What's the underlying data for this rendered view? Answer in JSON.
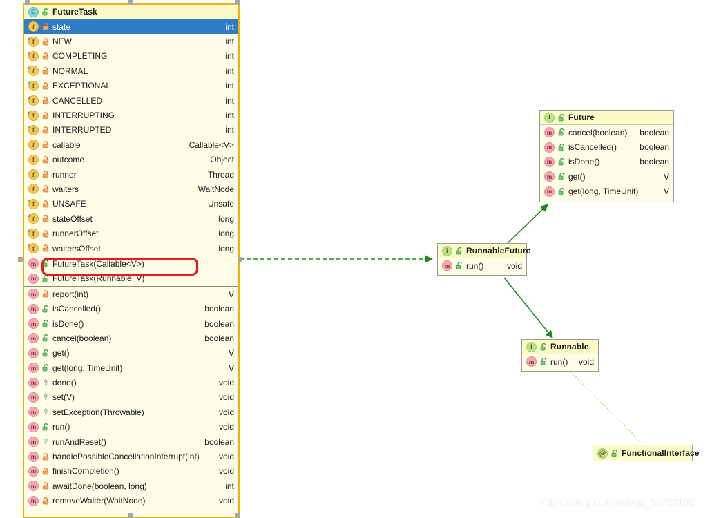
{
  "diagram": {
    "kind": "uml-class-diagram",
    "watermark": "https://blog.csdn.net/qq_33732195",
    "colors": {
      "box_fill": "#fdfde8",
      "header_fill": "#fbfbc8",
      "selected_border": "#f0b400",
      "row_selection": "#2f7bc4",
      "relation_green": "#1f8a1f",
      "relation_dotted": "#d6d69a",
      "annotation_red": "#e81b1b"
    }
  },
  "classes": {
    "future_task": {
      "name": "FutureTask",
      "stereotype": "class",
      "badge": "class-icon",
      "visibility": "public",
      "selected": true,
      "fields": [
        {
          "badge": "field-icon",
          "visibility": "private",
          "name": "state",
          "type": "int",
          "selected": true
        },
        {
          "badge": "static-field-icon",
          "visibility": "private",
          "name": "NEW",
          "type": "int",
          "selected": false
        },
        {
          "badge": "static-field-icon",
          "visibility": "private",
          "name": "COMPLETING",
          "type": "int",
          "selected": false
        },
        {
          "badge": "static-field-icon",
          "visibility": "private",
          "name": "NORMAL",
          "type": "int",
          "selected": false
        },
        {
          "badge": "static-field-icon",
          "visibility": "private",
          "name": "EXCEPTIONAL",
          "type": "int",
          "selected": false
        },
        {
          "badge": "static-field-icon",
          "visibility": "private",
          "name": "CANCELLED",
          "type": "int",
          "selected": false
        },
        {
          "badge": "static-field-icon",
          "visibility": "private",
          "name": "INTERRUPTING",
          "type": "int",
          "selected": false
        },
        {
          "badge": "static-field-icon",
          "visibility": "private",
          "name": "INTERRUPTED",
          "type": "int",
          "selected": false
        },
        {
          "badge": "field-icon",
          "visibility": "private",
          "name": "callable",
          "type": "Callable<V>",
          "selected": false
        },
        {
          "badge": "field-icon",
          "visibility": "private",
          "name": "outcome",
          "type": "Object",
          "selected": false
        },
        {
          "badge": "field-icon",
          "visibility": "private",
          "name": "runner",
          "type": "Thread",
          "selected": false
        },
        {
          "badge": "field-icon",
          "visibility": "private",
          "name": "waiters",
          "type": "WaitNode",
          "selected": false
        },
        {
          "badge": "static-field-icon",
          "visibility": "private",
          "name": "UNSAFE",
          "type": "Unsafe",
          "selected": false
        },
        {
          "badge": "static-field-icon",
          "visibility": "private",
          "name": "stateOffset",
          "type": "long",
          "selected": false
        },
        {
          "badge": "static-field-icon",
          "visibility": "private",
          "name": "runnerOffset",
          "type": "long",
          "selected": false
        },
        {
          "badge": "static-field-icon",
          "visibility": "private",
          "name": "waitersOffset",
          "type": "long",
          "selected": false
        }
      ],
      "constructors": [
        {
          "badge": "method-icon",
          "visibility": "public",
          "name": "FutureTask(Callable<V>)",
          "type": "",
          "highlighted": true
        },
        {
          "badge": "method-icon",
          "visibility": "public",
          "name": "FutureTask(Runnable, V)",
          "type": "",
          "highlighted": false
        }
      ],
      "methods": [
        {
          "badge": "method-icon",
          "visibility": "private",
          "name": "report(int)",
          "type": "V"
        },
        {
          "badge": "method-icon",
          "visibility": "public",
          "name": "isCancelled()",
          "type": "boolean"
        },
        {
          "badge": "method-icon",
          "visibility": "public",
          "name": "isDone()",
          "type": "boolean"
        },
        {
          "badge": "method-icon",
          "visibility": "public",
          "name": "cancel(boolean)",
          "type": "boolean"
        },
        {
          "badge": "method-icon",
          "visibility": "public",
          "name": "get()",
          "type": "V"
        },
        {
          "badge": "method-icon",
          "visibility": "public",
          "name": "get(long, TimeUnit)",
          "type": "V"
        },
        {
          "badge": "method-icon",
          "visibility": "protected",
          "name": "done()",
          "type": "void"
        },
        {
          "badge": "method-icon",
          "visibility": "protected",
          "name": "set(V)",
          "type": "void"
        },
        {
          "badge": "method-icon",
          "visibility": "protected",
          "name": "setException(Throwable)",
          "type": "void"
        },
        {
          "badge": "method-icon",
          "visibility": "public",
          "name": "run()",
          "type": "void"
        },
        {
          "badge": "method-icon",
          "visibility": "protected",
          "name": "runAndReset()",
          "type": "boolean"
        },
        {
          "badge": "method-icon",
          "visibility": "private",
          "name": "handlePossibleCancellationInterrupt(int)",
          "type": "void"
        },
        {
          "badge": "method-icon",
          "visibility": "private",
          "name": "finishCompletion()",
          "type": "void"
        },
        {
          "badge": "method-icon",
          "visibility": "private",
          "name": "awaitDone(boolean, long)",
          "type": "int"
        },
        {
          "badge": "method-icon",
          "visibility": "private",
          "name": "removeWaiter(WaitNode)",
          "type": "void"
        }
      ]
    },
    "future": {
      "name": "Future",
      "stereotype": "interface",
      "badge": "interface-icon",
      "visibility": "public",
      "methods": [
        {
          "badge": "method-icon",
          "visibility": "public",
          "name": "cancel(boolean)",
          "type": "boolean"
        },
        {
          "badge": "method-icon",
          "visibility": "public",
          "name": "isCancelled()",
          "type": "boolean"
        },
        {
          "badge": "method-icon",
          "visibility": "public",
          "name": "isDone()",
          "type": "boolean"
        },
        {
          "badge": "method-icon",
          "visibility": "public",
          "name": "get()",
          "type": "V"
        },
        {
          "badge": "method-icon",
          "visibility": "public",
          "name": "get(long, TimeUnit)",
          "type": "V"
        }
      ]
    },
    "runnable_future": {
      "name": "RunnableFuture",
      "stereotype": "interface",
      "badge": "interface-icon",
      "visibility": "public",
      "methods": [
        {
          "badge": "method-icon",
          "visibility": "public",
          "name": "run()",
          "type": "void"
        }
      ]
    },
    "runnable": {
      "name": "Runnable",
      "stereotype": "interface",
      "badge": "interface-icon",
      "visibility": "public",
      "methods": [
        {
          "badge": "method-icon",
          "visibility": "public",
          "name": "run()",
          "type": "void"
        }
      ]
    },
    "functional_interface": {
      "name": "FunctionalInterface",
      "stereotype": "annotation",
      "badge": "annotation-icon",
      "visibility": "public",
      "methods": []
    }
  },
  "relations": [
    {
      "from": "FutureTask",
      "to": "RunnableFuture",
      "type": "realization",
      "style": "dashed",
      "color": "#1f8a1f"
    },
    {
      "from": "RunnableFuture",
      "to": "Future",
      "type": "generalization",
      "style": "solid",
      "color": "#1f8a1f"
    },
    {
      "from": "RunnableFuture",
      "to": "Runnable",
      "type": "generalization",
      "style": "solid",
      "color": "#1f8a1f"
    },
    {
      "from": "Runnable",
      "to": "FunctionalInterface",
      "type": "annotation-link",
      "style": "dotted",
      "color": "#d6d69a"
    }
  ]
}
